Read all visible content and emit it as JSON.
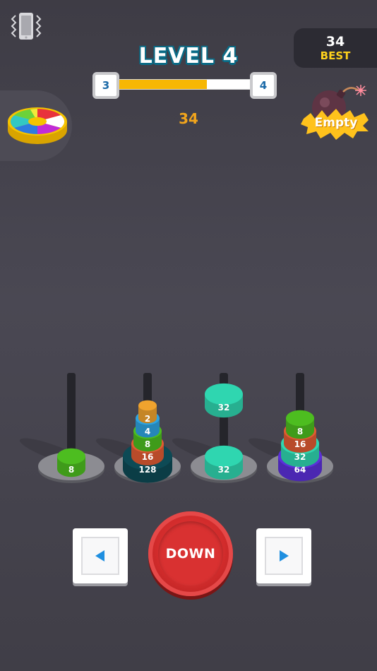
{
  "header": {
    "level_title": "LEVEL 4",
    "current_level": "3",
    "next_level": "4",
    "progress": 0.66,
    "score": "34"
  },
  "best": {
    "value": "34",
    "label": "BEST"
  },
  "bomb": {
    "status": "Empty"
  },
  "colors": {
    "background": "#45434d",
    "progress_fill": "#f7b703",
    "down_button": "#d93131",
    "accent_yellow": "#ffd21c"
  },
  "icons": [
    "vibrate-icon",
    "spin-wheel-icon",
    "bomb-icon",
    "left-arrow-icon",
    "right-arrow-icon"
  ],
  "towers": [
    {
      "discs": [
        {
          "value": "8",
          "color": "#4dbd20"
        }
      ],
      "held": null
    },
    {
      "discs": [
        {
          "value": "128",
          "color": "#0d4a55"
        },
        {
          "value": "16",
          "color": "#e05b33"
        },
        {
          "value": "8",
          "color": "#4dbd20"
        },
        {
          "value": "4",
          "color": "#2ea3e0"
        },
        {
          "value": "2",
          "color": "#f0a32e"
        }
      ],
      "held": null
    },
    {
      "discs": [
        {
          "value": "32",
          "color": "#2fd6b0"
        }
      ],
      "held": {
        "value": "32",
        "color": "#2fd6b0"
      }
    },
    {
      "discs": [
        {
          "value": "64",
          "color": "#5b2fd9"
        },
        {
          "value": "32",
          "color": "#2fd6b0"
        },
        {
          "value": "16",
          "color": "#e05b33"
        },
        {
          "value": "8",
          "color": "#4dbd20"
        }
      ],
      "held": null
    }
  ],
  "controls": {
    "down_label": "DOWN"
  }
}
